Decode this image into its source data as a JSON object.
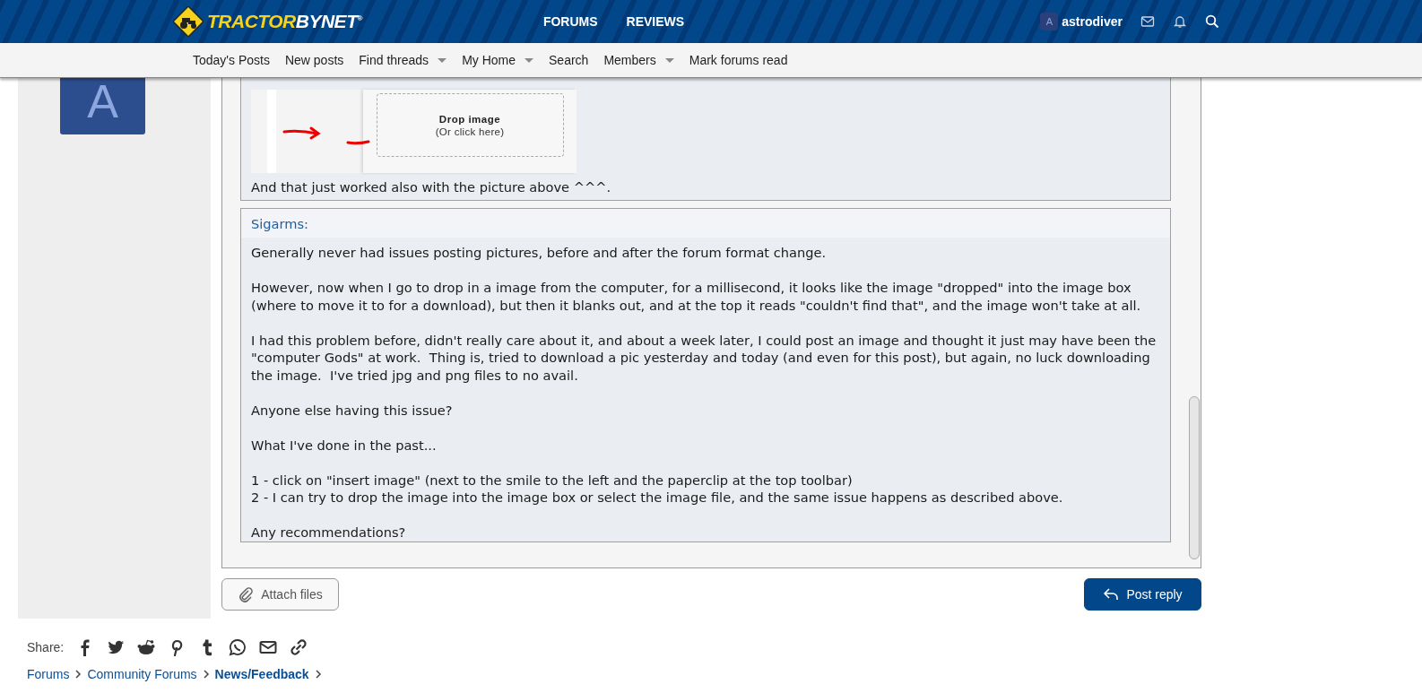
{
  "header": {
    "logo": {
      "text_1": "TRACTOR",
      "text_2": "BYNET",
      "mark": "®"
    },
    "nav_tabs": [
      {
        "label": "FORUMS",
        "selected": false
      },
      {
        "label": "REVIEWS",
        "selected": false
      }
    ],
    "user": {
      "avatar_letter": "A",
      "name": "astrodiver"
    }
  },
  "subnav": [
    {
      "label": "Today's Posts",
      "dropdown": false
    },
    {
      "label": "New posts",
      "dropdown": false
    },
    {
      "label": "Find threads",
      "dropdown": true
    },
    {
      "label": "My Home",
      "dropdown": true
    },
    {
      "label": "Search",
      "dropdown": false
    },
    {
      "label": "Members",
      "dropdown": true
    },
    {
      "label": "Mark forums read",
      "dropdown": false
    }
  ],
  "sidebar": {
    "avatar_letter": "A"
  },
  "editor": {
    "quotes": [
      {
        "kind": "note",
        "screenshot": {
          "title": "Drop image",
          "hint": "(Or click here)"
        },
        "text": "And that just worked also with the picture above ^^^."
      },
      {
        "kind": "quote",
        "author": "Sigarms:",
        "paragraphs": [
          [
            "Generally never had issues posting pictures, before and after the forum format change."
          ],
          [
            "However, now when I go to drop in a image from the computer, for a millisecond, it looks like the image \"dropped\" into the image box (where to move it to for a download), but then it blanks out, and at the top it reads \"couldn't find that\", and the image won't take at all."
          ],
          [
            "I had this problem before, didn't really care about it, and about a week later, I could post an image and thought it just may have been the \"computer Gods\" at work.  Thing is, tried to download a pic yesterday and today (and even for this post), but again, no luck downloading the image.  I've tried jpg and png files to no avail."
          ],
          [
            "Anyone else having this issue?"
          ],
          [
            "What I've done in the past..."
          ],
          [
            "1 - click on \"insert image\" (next to the smile to the left and the paperclip at the top toolbar)",
            "2 - I can try to drop the image into the image box or select the image file, and the same issue happens as described above."
          ],
          [
            "Any recommendations?"
          ]
        ]
      }
    ]
  },
  "buttons": [
    {
      "label": "Attach files",
      "kind": "secondary"
    },
    {
      "label": "Post reply",
      "kind": "primary"
    }
  ],
  "share": {
    "label": "Share:"
  },
  "breadcrumb": [
    {
      "label": "Forums",
      "current": false
    },
    {
      "label": "Community Forums",
      "current": false
    },
    {
      "label": "News/Feedback",
      "current": true
    }
  ]
}
